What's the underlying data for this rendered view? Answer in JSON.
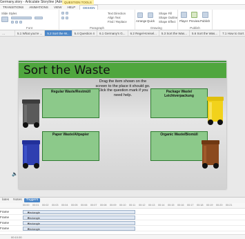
{
  "titlebar": {
    "title": "Germany.story - Articulate Storyline (Administrator)",
    "tools_tab": "QUESTION TOOLS"
  },
  "ribbon_tabs": [
    "TRANSITIONS",
    "ANIMATIONS",
    "VIEW",
    "HELP",
    "DESIGN"
  ],
  "ribbon": {
    "groups": {
      "font": "Font",
      "paragraph": "Paragraph",
      "drawing": "Drawing",
      "publish": "Publish"
    },
    "slide_styles": "Slide Styles",
    "text_direction": "Text Direction",
    "align_text": "Align Text",
    "find_replace": "Find / Replace",
    "shape_fill": "Shape Fill",
    "shape_outline": "Shape Outline",
    "shape_effect": "Shape Effect",
    "arrange": "Arrange",
    "quick": "Quick",
    "player": "Player",
    "preview": "Preview",
    "publish_btn": "Publish"
  },
  "slide_tabs": [
    {
      "label": "5.1 What you're ...",
      "active": false
    },
    {
      "label": "5.2 Sort the W...",
      "active": true
    },
    {
      "label": "5.4 Question 4",
      "active": false
    },
    {
      "label": "6.1 Germany's G...",
      "active": false
    },
    {
      "label": "6.2 Regel-Kreisel...",
      "active": false
    },
    {
      "label": "5.3 Sort the Was...",
      "active": false
    },
    {
      "label": "5.6 Sort the Was...",
      "active": false
    },
    {
      "label": "7.1 How to Sort ...",
      "active": false
    }
  ],
  "slide": {
    "title": "Sort the Waste",
    "instructions": "Drag the item shown on the screen to the place it should go. Click the question mark if you need help.",
    "zones": {
      "regular": "Regular Waste/Restmüll",
      "paper": "Paper Waste/Altpapier",
      "package": "Package Waste/ Leichtverpackung",
      "organic": "Organic Waste/Biomüll"
    }
  },
  "colors": {
    "header_green": "#4fa63e",
    "zone_green": "#8cc98a",
    "bin_grey": "#5a5a5a",
    "bin_blue": "#2f3fb0",
    "bin_yellow": "#f2d21b",
    "bin_brown": "#8b4a1f",
    "accent_blue": "#4a86c8"
  },
  "timeline": {
    "tabs": [
      {
        "label": "lates",
        "active": false
      },
      {
        "label": "Notes",
        "active": false
      },
      {
        "label": "Triggers",
        "active": true
      }
    ],
    "ruler": [
      "00:00",
      "00:01",
      "00:02",
      "00:03",
      "00:04",
      "00:05",
      "00:06",
      "00:07",
      "00:08",
      "00:09",
      "00:10",
      "00:11",
      "00:12",
      "00:13",
      "00:14",
      "00:15",
      "00:16",
      "00:17",
      "00:18",
      "00:19",
      "00:20",
      "00:21"
    ],
    "rows": [
      {
        "name": "Frame",
        "object": "Rectangle"
      },
      {
        "name": "Frame",
        "object": "Rectangle"
      },
      {
        "name": "Frame",
        "object": "Rectangle"
      },
      {
        "name": "Frame",
        "object": "Rectangle"
      }
    ],
    "footer_time": "00:10.00"
  }
}
